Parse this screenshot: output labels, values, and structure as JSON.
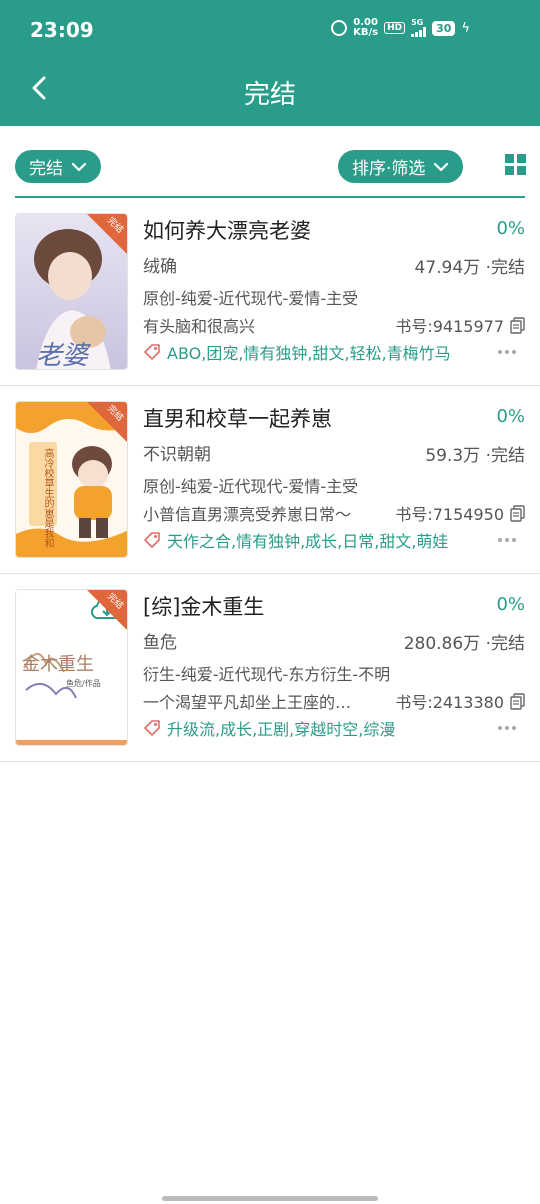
{
  "status_bar": {
    "time": "23:09",
    "net_speed_value": "0.00",
    "net_speed_unit": "KB/s",
    "hd": "HD",
    "signal": "5G",
    "battery": "30"
  },
  "header": {
    "title": "完结",
    "back_icon": "chevron-left-icon"
  },
  "filters": {
    "status_chip": "完结",
    "sort_chip": "排序·筛选",
    "layout_icon": "grid-view-icon"
  },
  "colors": {
    "accent": "#2a9d8a",
    "tag_icon": "#e46a6a"
  },
  "books": [
    {
      "title": "如何养大漂亮老婆",
      "progress": "0%",
      "author": "绒确",
      "count": "47.94万 ·完结",
      "categories": "原创-纯爱-近代现代-爱情-主受",
      "intro": "有头脑和很高兴",
      "book_id": "书号:9415977",
      "tags": "ABO,团宠,情有独钟,甜文,轻松,青梅竹马",
      "cover_badge": "完结"
    },
    {
      "title": "直男和校草一起养崽",
      "progress": "0%",
      "author": "不识朝朝",
      "count": "59.3万 ·完结",
      "categories": "原创-纯爱-近代现代-爱情-主受",
      "intro": "小普信直男漂亮受养崽日常～",
      "book_id": "书号:7154950",
      "tags": "天作之合,情有独钟,成长,日常,甜文,萌娃",
      "cover_badge": "完结",
      "cover_text": "高冷校草生的崽是我和"
    },
    {
      "title": "[综]金木重生",
      "progress": "0%",
      "author": "鱼危",
      "count": "280.86万 ·完结",
      "categories": "衍生-纯爱-近代现代-东方衍生-不明",
      "intro": "一个渴望平凡却坐上王座的…",
      "book_id": "书号:2413380",
      "tags": "升级流,成长,正剧,穿越时空,综漫",
      "cover_badge": "完结",
      "cover_title": "金木重生",
      "cover_byline": "鱼危/作品"
    }
  ]
}
